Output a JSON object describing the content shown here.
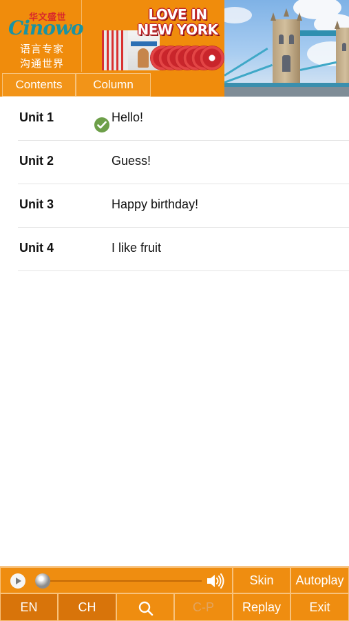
{
  "header": {
    "logo": {
      "cn_top": "华文盛世",
      "brand": "Cinowo",
      "line1": "语言专家",
      "line2": "沟通世界"
    },
    "banner_title_line1": "LOVE IN",
    "banner_title_line2": "NEW YORK",
    "tabs": [
      {
        "label": "Contents"
      },
      {
        "label": "Column"
      }
    ]
  },
  "units": [
    {
      "unit": "Unit 1",
      "title": "Hello!",
      "completed": true
    },
    {
      "unit": "Unit 2",
      "title": "Guess!",
      "completed": false
    },
    {
      "unit": "Unit 3",
      "title": "Happy birthday!",
      "completed": false
    },
    {
      "unit": "Unit 4",
      "title": "I like fruit",
      "completed": false
    }
  ],
  "player": {
    "progress": 0,
    "play_icon": "play-icon",
    "volume_icon": "speaker-icon"
  },
  "controls": {
    "skin": "Skin",
    "autoplay": "Autoplay",
    "en": "EN",
    "ch": "CH",
    "search_icon": "magnifier-icon",
    "cp": "C-P",
    "replay": "Replay",
    "exit": "Exit"
  },
  "colors": {
    "accent": "#f08c0c",
    "accent_dark": "#d8740a",
    "check": "#6d9f49",
    "disabled_text": "#e2a45f"
  }
}
